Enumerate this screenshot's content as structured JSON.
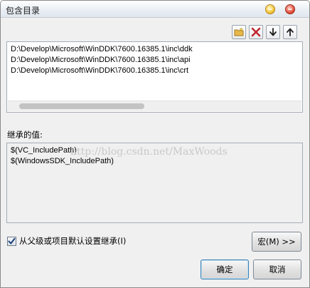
{
  "window": {
    "title": "包含目录"
  },
  "toolbar": {
    "buttons": [
      {
        "name": "new-line-button",
        "icon": "new-folder-icon"
      },
      {
        "name": "delete-button",
        "icon": "delete-x-icon"
      },
      {
        "name": "move-down-button",
        "icon": "arrow-down-icon"
      },
      {
        "name": "move-up-button",
        "icon": "arrow-up-icon"
      }
    ]
  },
  "directories": [
    "D:\\Develop\\Microsoft\\WinDDK\\7600.16385.1\\inc\\ddk",
    "D:\\Develop\\Microsoft\\WinDDK\\7600.16385.1\\inc\\api",
    "D:\\Develop\\Microsoft\\WinDDK\\7600.16385.1\\inc\\crt"
  ],
  "inherited": {
    "label": "继承的值:",
    "values": [
      "$(VC_IncludePath)",
      "$(WindowsSDK_IncludePath)"
    ]
  },
  "watermark": "http://blog.csdn.net/MaxWoods",
  "inherit_checkbox": {
    "label": "从父级或项目默认设置继承(I)",
    "checked": true
  },
  "buttons": {
    "macro": "宏(M) >>",
    "ok": "确定",
    "cancel": "取消"
  },
  "colors": {
    "delete_icon": "#c0272d",
    "new_folder_icon": "#e8b84a"
  }
}
